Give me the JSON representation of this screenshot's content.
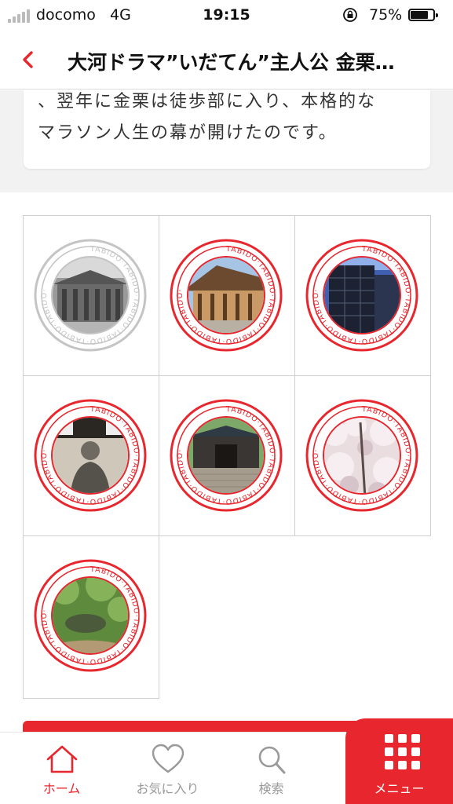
{
  "status_bar": {
    "carrier": "docomo",
    "network": "4G",
    "time": "19:15",
    "battery": "75%"
  },
  "header": {
    "back_icon": "chevron-left-icon",
    "title": "大河ドラマ”いだてん”主人公 金栗…"
  },
  "card": {
    "lines": [
      "、翌年に金栗は徒歩部に入り、本格的な",
      "マラソン人生の幕が開けたのです。"
    ]
  },
  "stamps": {
    "ring_text": "TABIDO·TABIDO·TABIDO·TABIDO·TABIDO·TABIDO·",
    "items": [
      {
        "collected": false,
        "scene": "wooden-building"
      },
      {
        "collected": true,
        "scene": "temple"
      },
      {
        "collected": true,
        "scene": "modern-building"
      },
      {
        "collected": true,
        "scene": "statue"
      },
      {
        "collected": true,
        "scene": "shrine-gate"
      },
      {
        "collected": true,
        "scene": "cherry-blossoms"
      },
      {
        "collected": true,
        "scene": "garden"
      }
    ]
  },
  "tabbar": {
    "items": [
      {
        "label": "ホーム",
        "icon": "home-icon",
        "active": true
      },
      {
        "label": "お気に入り",
        "icon": "heart-icon",
        "active": false
      },
      {
        "label": "検索",
        "icon": "search-icon",
        "active": false
      }
    ],
    "menu": {
      "label": "メニュー",
      "icon": "grid-menu-icon"
    }
  },
  "colors": {
    "accent": "#e8262d",
    "inactive_stamp": "#c4c4c4",
    "tab_inactive": "#999999"
  }
}
